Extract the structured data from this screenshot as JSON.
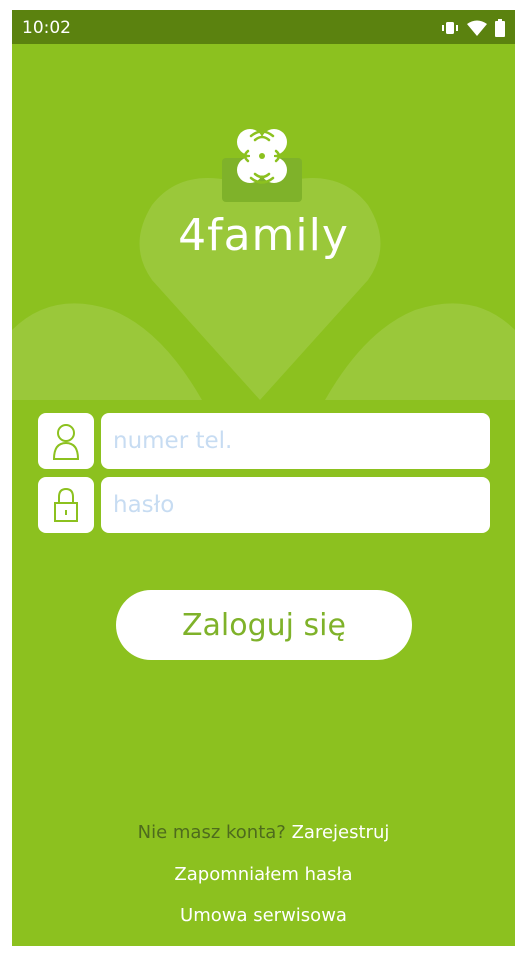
{
  "status_bar": {
    "time": "10:02",
    "icons": [
      "vibrate-icon",
      "wifi-icon",
      "battery-icon"
    ]
  },
  "app": {
    "name": "4family",
    "logo": "clover-signal-logo"
  },
  "form": {
    "phone_placeholder": "numer tel.",
    "password_placeholder": "hasło",
    "phone_icon": "user-icon",
    "password_icon": "lock-icon"
  },
  "login_button": {
    "label": "Zaloguj się"
  },
  "links": {
    "no_account": "Nie masz konta?",
    "register": "Zarejestruj",
    "forgot_password": "Zapomniałem hasła",
    "service_agreement": "Umowa serwisowa"
  },
  "colors": {
    "background": "#8cc11f",
    "status_bar": "#5b820f",
    "accent_text": "#7fb22a",
    "white": "#ffffff"
  }
}
